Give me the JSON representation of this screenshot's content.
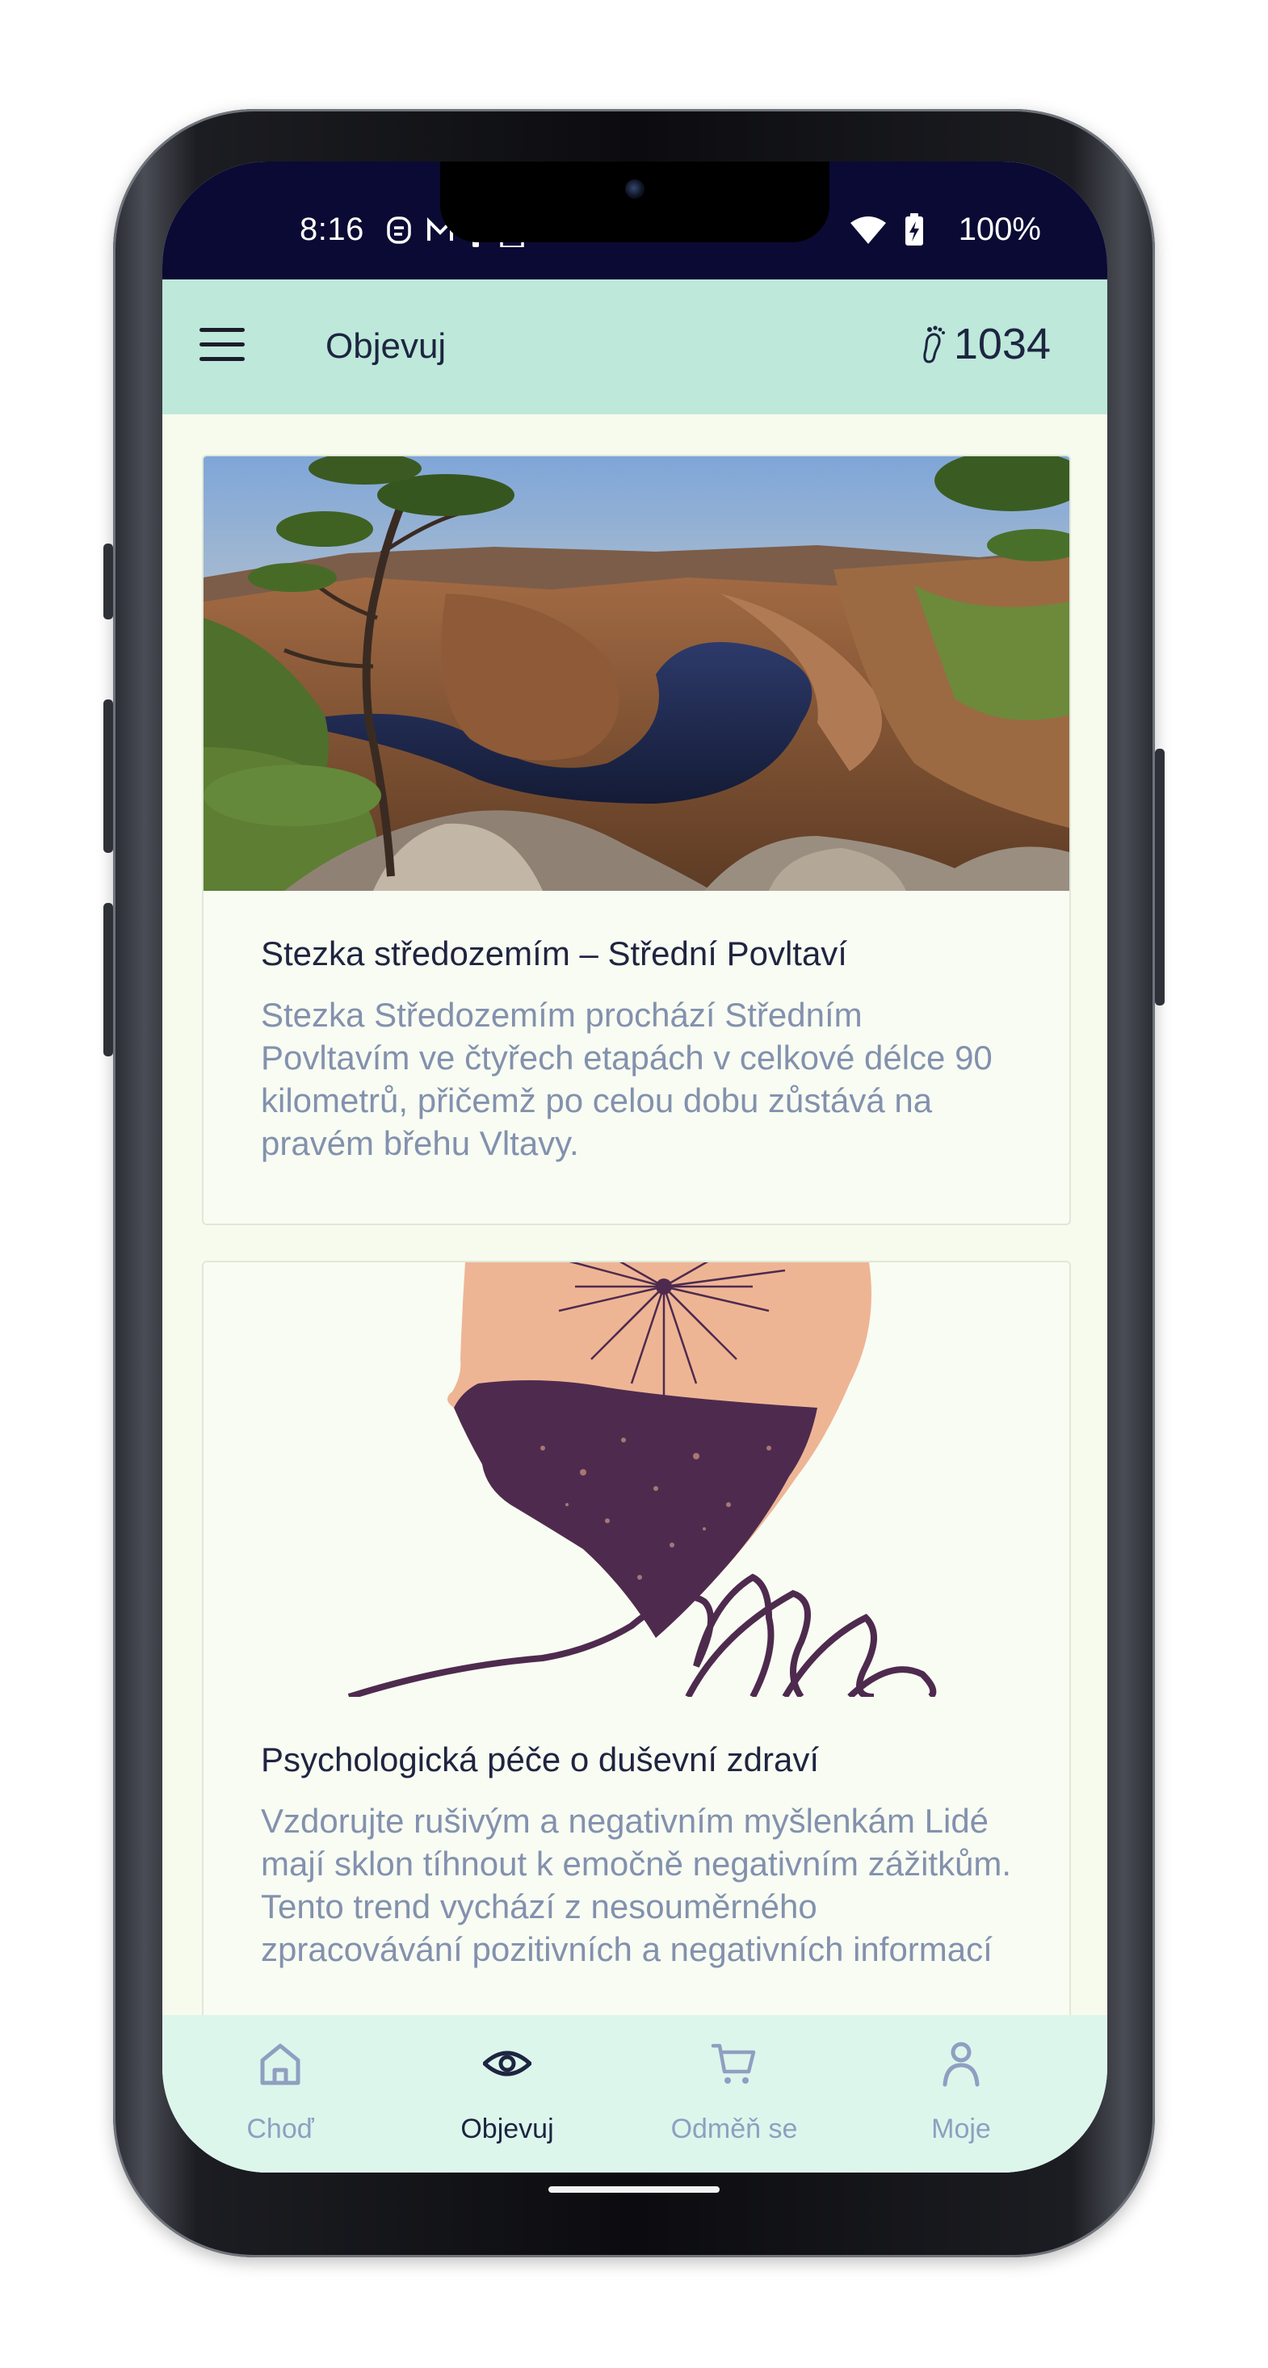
{
  "status_bar": {
    "time": "8:16",
    "battery_percent": "100%",
    "left_icons": [
      "alarm-icon",
      "gmail-icon",
      "phone-icon",
      "sim-icon"
    ],
    "right_icons": [
      "wifi-icon",
      "battery-charging-icon"
    ]
  },
  "app_bar": {
    "title": "Objevuj",
    "menu_icon": "hamburger-menu-icon",
    "steps_icon": "footprint-icon",
    "steps_count": "1034"
  },
  "cards": [
    {
      "image": "landscape-river-meander-photo",
      "title": "Stezka středozemím – Střední Povltaví",
      "text": "Stezka Středozemím prochází Středním Povltavím ve čtyřech etapách v celkové délce 90 kilometrů, přičemž po celou dobu zůstává na pravém břehu Vltavy."
    },
    {
      "image": "head-silhouette-illustration",
      "title": "Psychologická péče o duševní zdraví",
      "text": "Vzdorujte rušivým a negativním myšlenkám Lidé mají sklon tíhnout k emočně negativním zážitkům. Tento trend vychází z nesouměrného zpracovávání pozitivních a negativních informací"
    }
  ],
  "bottom_nav": {
    "items": [
      {
        "label": "Choď",
        "icon": "home-icon"
      },
      {
        "label": "Objevuj",
        "icon": "eye-icon"
      },
      {
        "label": "Odměň se",
        "icon": "cart-icon"
      },
      {
        "label": "Moje",
        "icon": "person-icon"
      }
    ],
    "active_index": 1
  },
  "colors": {
    "status_bar": "#0b0a34",
    "app_bar": "#bde8da",
    "background": "#f6fbee",
    "bottom_nav": "#ddf6ec",
    "title_text": "#1d2540",
    "muted_text": "#8391ae",
    "illustration_purple": "#4e2b4e",
    "illustration_peach": "#eeb595"
  }
}
